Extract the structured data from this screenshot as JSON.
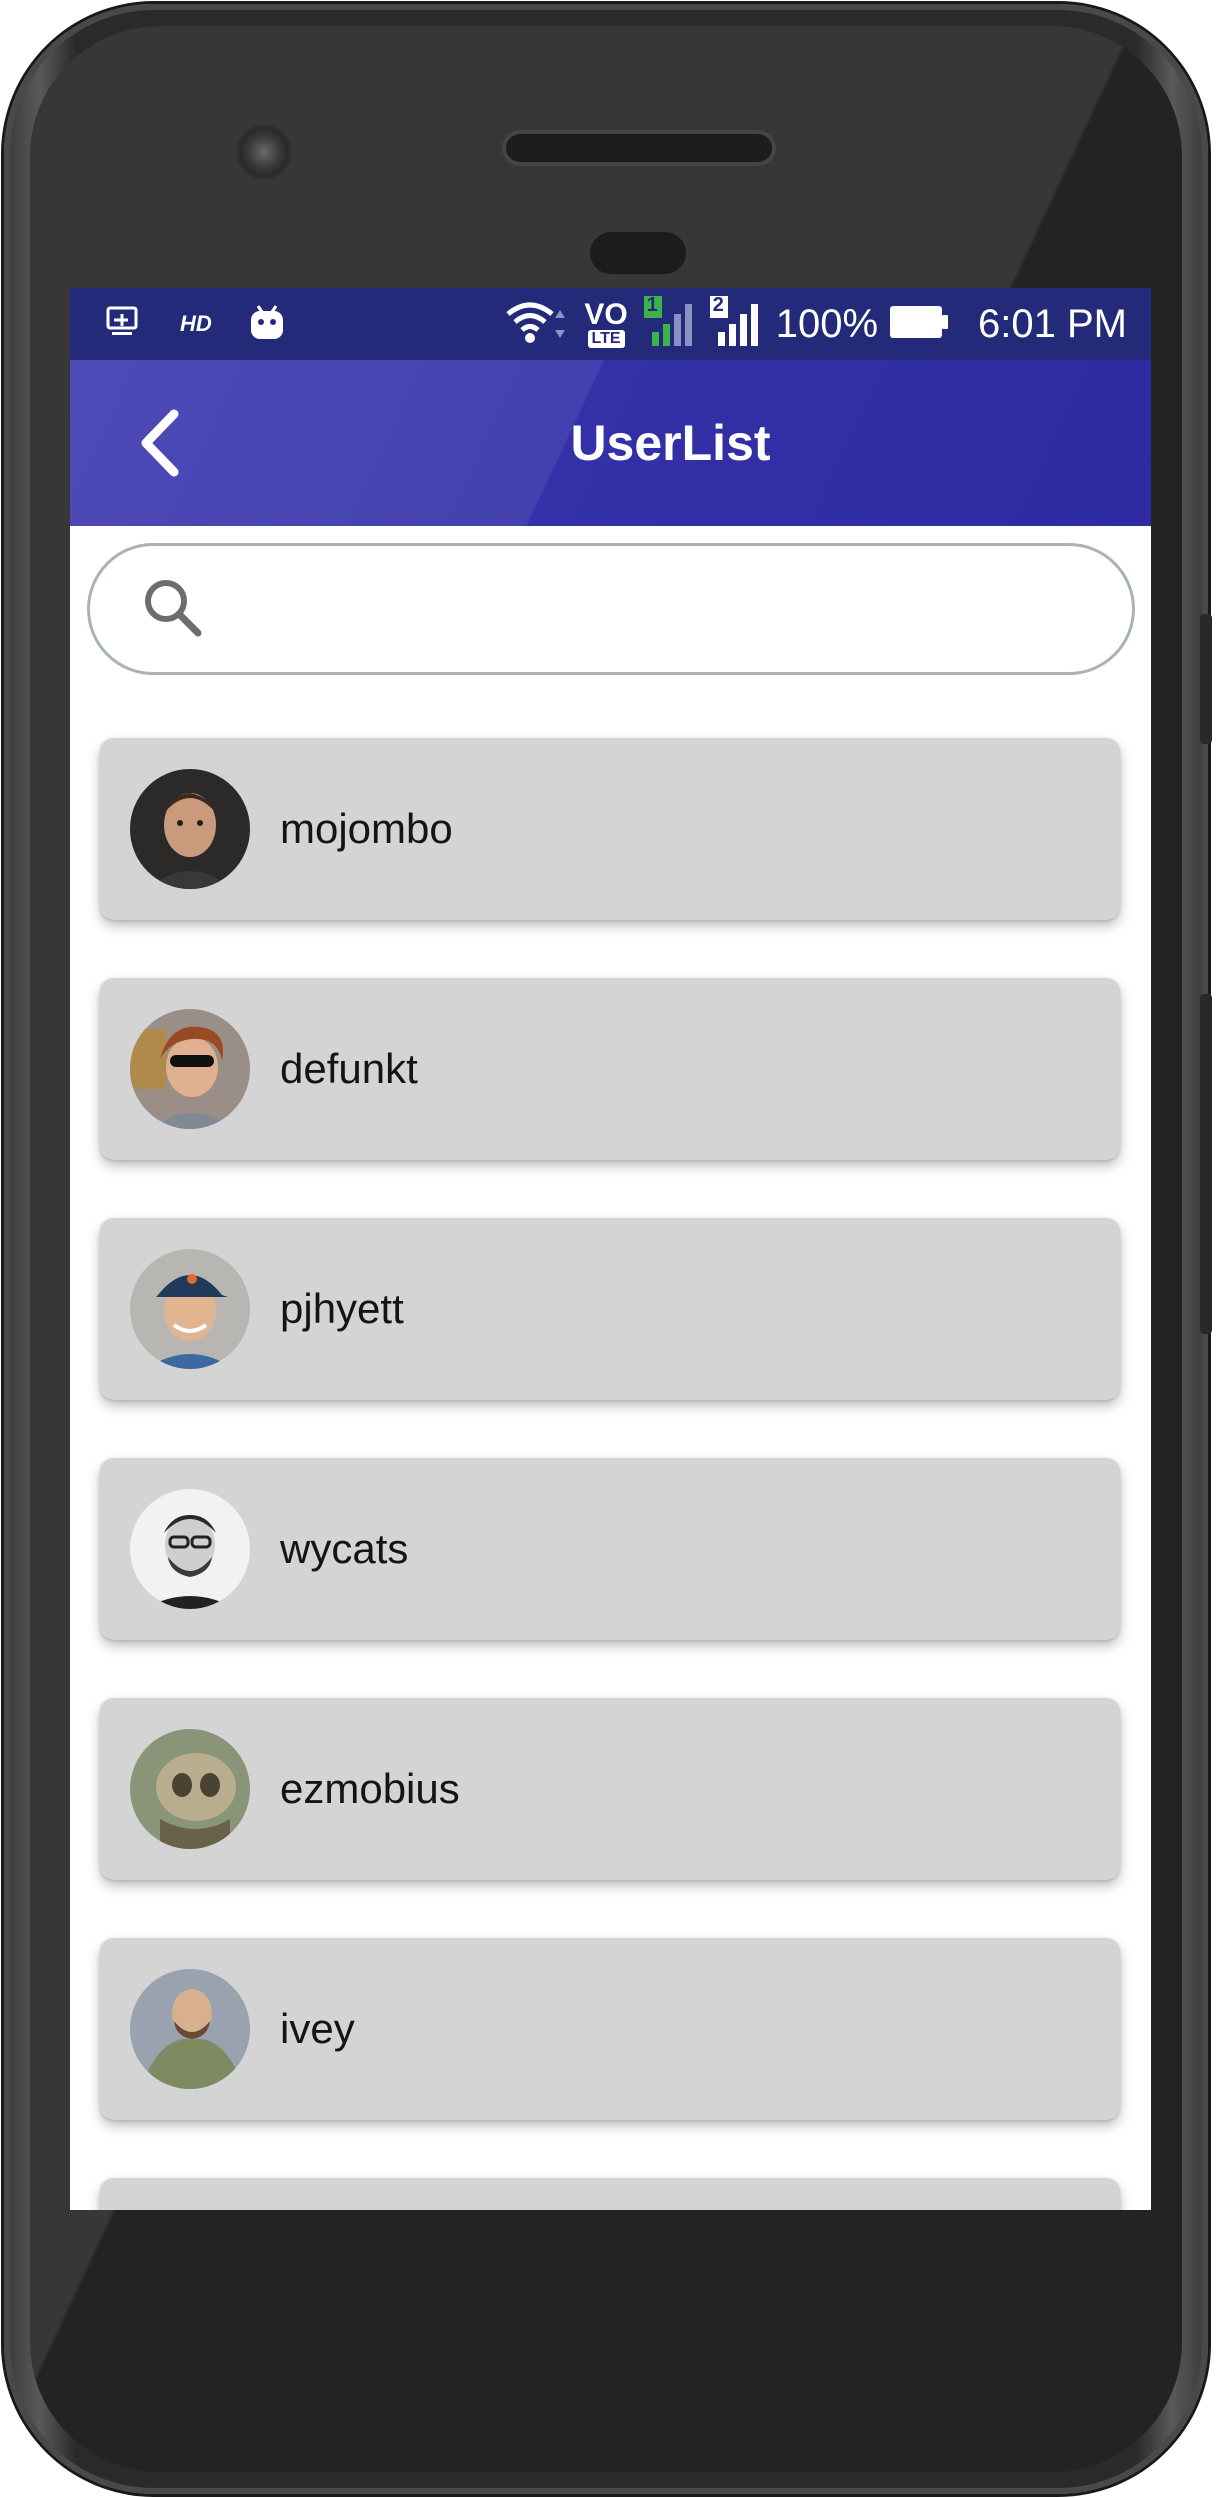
{
  "status_bar": {
    "hd_label": "HD",
    "volte_top": "VO",
    "volte_bottom": "LTE",
    "sim1": "1",
    "sim2": "2",
    "battery": "100%",
    "time": "6:01 PM"
  },
  "app_bar": {
    "title": "UserList",
    "back_icon": "chevron-left-icon"
  },
  "search": {
    "placeholder": "",
    "value": "",
    "icon": "search-icon"
  },
  "users": [
    {
      "login": "mojombo"
    },
    {
      "login": "defunkt"
    },
    {
      "login": "pjhyett"
    },
    {
      "login": "wycats"
    },
    {
      "login": "ezmobius"
    },
    {
      "login": "ivey"
    }
  ],
  "colors": {
    "status_bar": "#232a79",
    "app_bar": "#3a37ac",
    "card": "#d4d4d4",
    "search_border": "#a9b2b6"
  }
}
